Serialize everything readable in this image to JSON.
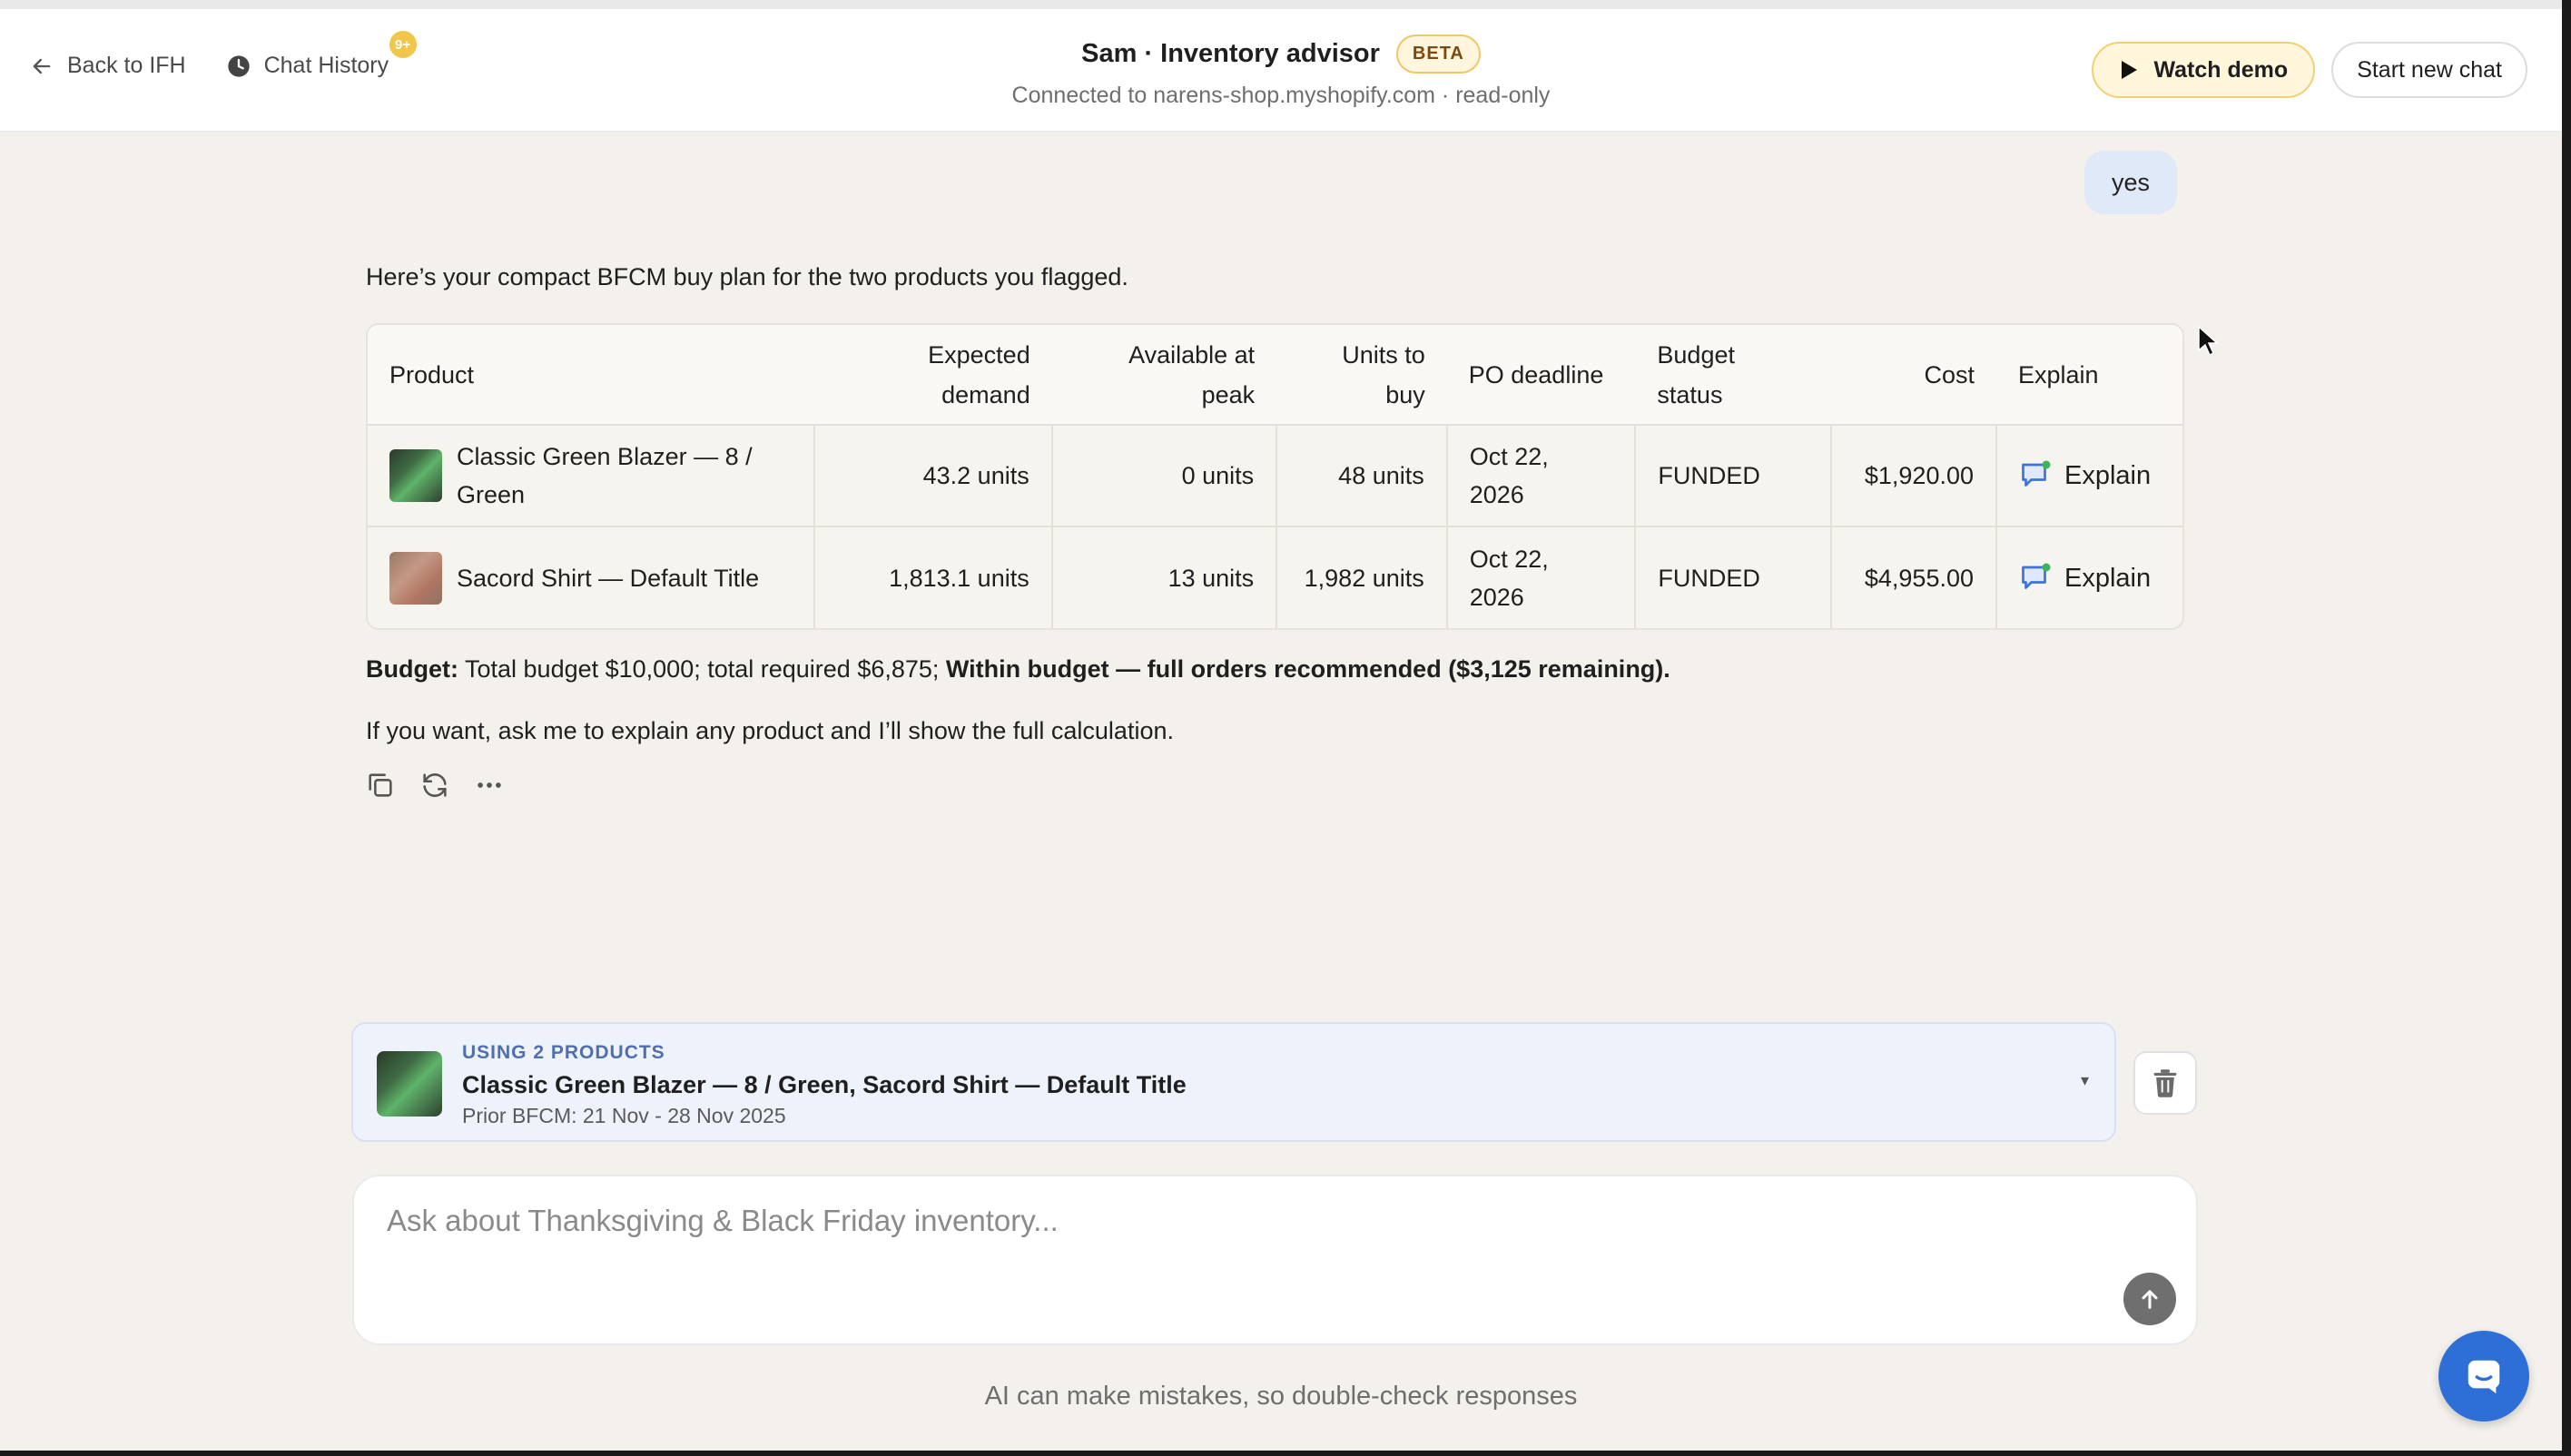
{
  "header": {
    "back_label": "Back to IFH",
    "history_label": "Chat History",
    "history_badge": "9+",
    "title": "Sam · Inventory advisor",
    "beta_badge": "BETA",
    "subtitle": "Connected to narens-shop.myshopify.com · read-only",
    "watch_demo_label": "Watch demo",
    "new_chat_label": "Start new chat"
  },
  "conversation": {
    "user_message": "yes",
    "assistant_intro": "Here’s your compact BFCM buy plan for the two products you flagged.",
    "table": {
      "headers": {
        "product": "Product",
        "expected_demand": "Expected demand",
        "available_at_peak": "Available at peak",
        "units_to_buy": "Units to buy",
        "po_deadline": "PO deadline",
        "budget_status": "Budget status",
        "cost": "Cost",
        "explain": "Explain"
      },
      "rows": [
        {
          "product": "Classic Green Blazer — 8 / Green",
          "expected_demand": "43.2 units",
          "available_at_peak": "0 units",
          "units_to_buy": "48 units",
          "po_deadline": "Oct 22, 2026",
          "budget_status": "FUNDED",
          "cost": "$1,920.00",
          "explain_label": "Explain"
        },
        {
          "product": "Sacord Shirt — Default Title",
          "expected_demand": "1,813.1 units",
          "available_at_peak": "13 units",
          "units_to_buy": "1,982 units",
          "po_deadline": "Oct 22, 2026",
          "budget_status": "FUNDED",
          "cost": "$4,955.00",
          "explain_label": "Explain"
        }
      ]
    },
    "budget_label": "Budget:",
    "budget_text": " Total budget $10,000; total required $6,875; ",
    "budget_emphasis": "Within budget — full orders recommended ($3,125 remaining).",
    "followup": "If you want, ask me to explain any product and I’ll show the full calculation.",
    "actions": [
      "copy-icon",
      "regenerate-icon",
      "more-icon"
    ]
  },
  "context": {
    "label": "USING 2 PRODUCTS",
    "title": "Classic Green Blazer — 8 / Green, Sacord Shirt — Default Title",
    "subtitle": "Prior BFCM: 21 Nov - 28 Nov 2025",
    "caret": "▾"
  },
  "composer": {
    "placeholder": "Ask about Thanksgiving & Black Friday inventory...",
    "value": ""
  },
  "footer": {
    "disclaimer": "AI can make mistakes, so double-check responses"
  },
  "colors": {
    "background": "#f4f1ec",
    "accent_yellow": "#f2cf72",
    "user_bubble": "#dfe9f8",
    "context_card": "#eef2fb",
    "launcher": "#2d6fd6"
  }
}
